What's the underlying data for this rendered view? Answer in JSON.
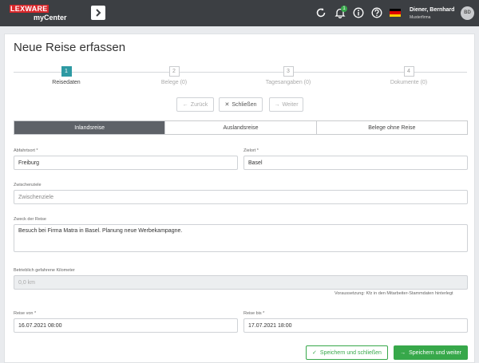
{
  "topbar": {
    "brand": "LEXWARE",
    "product": "myCenter",
    "notification_count": "1",
    "user_name": "Diener, Bernhard",
    "user_company": "Musterfirma",
    "avatar_initials": "BD",
    "icons": [
      "menu-collapse-icon",
      "refresh-icon",
      "bell-icon",
      "info-icon",
      "help-icon",
      "flag-de-icon"
    ],
    "accent": "#d9262a"
  },
  "page": {
    "title": "Neue Reise erfassen"
  },
  "stepper": {
    "steps": [
      {
        "number": "1",
        "label": "Reisedaten",
        "active": true
      },
      {
        "number": "2",
        "label": "Belege (0)",
        "active": false
      },
      {
        "number": "3",
        "label": "Tagesangaben (0)",
        "active": false
      },
      {
        "number": "4",
        "label": "Dokumente (0)",
        "active": false
      }
    ],
    "accent": "#2e9aa3"
  },
  "nav": {
    "back": "Zurück",
    "close": "Schließen",
    "next": "Weiter"
  },
  "tabs": {
    "items": [
      "Inlandsreise",
      "Auslandsreise",
      "Belege ohne Reise"
    ],
    "active_index": 0
  },
  "form": {
    "departure": {
      "label": "Abfahrtsort *",
      "value": "Freiburg"
    },
    "destination": {
      "label": "Zielort *",
      "value": "Basel"
    },
    "stops": {
      "label": "Zwischenziele",
      "placeholder": "Zwischenziele"
    },
    "purpose": {
      "label": "Zweck der Reise",
      "value": "Besuch bei Firma Matra in Basel. Planung neue Werbekampagne."
    },
    "km": {
      "label": "Betrieblich gefahrene Kilometer",
      "value": "0,0 km",
      "note": "Voraussetzung: Kfz in den Mitarbeiter-Stammdaten hinterlegt"
    },
    "trip_from": {
      "label": "Reise von *",
      "value": "16.07.2021 08:00"
    },
    "trip_to": {
      "label": "Reise bis *",
      "value": "17.07.2021 18:00"
    }
  },
  "footer": {
    "save_close": "Speichern und schließen",
    "save_next": "Speichern und weiter",
    "accent": "#37a84a"
  }
}
